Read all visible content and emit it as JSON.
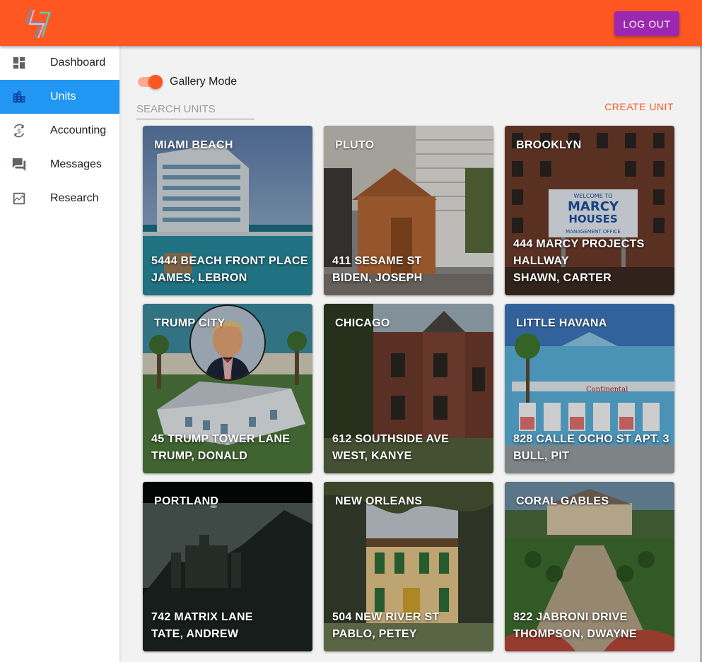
{
  "topbar": {
    "logout_label": "LOG OUT",
    "logo_icon": "lightning-logo-icon",
    "color": "#ff5722",
    "logout_color": "#9c27b0"
  },
  "sidebar": {
    "active_color": "#2196f3",
    "items": [
      {
        "label": "Dashboard",
        "icon": "dashboard-icon",
        "active": false
      },
      {
        "label": "Units",
        "icon": "building-icon",
        "active": true
      },
      {
        "label": "Accounting",
        "icon": "money-sync-icon",
        "active": false
      },
      {
        "label": "Messages",
        "icon": "chat-icon",
        "active": false
      },
      {
        "label": "Research",
        "icon": "chart-icon",
        "active": false
      }
    ]
  },
  "main": {
    "gallery_mode_label": "Gallery Mode",
    "gallery_mode_on": true,
    "search_placeholder": "SEARCH UNITS",
    "search_value": "",
    "create_unit_label": "CREATE UNIT",
    "units": [
      {
        "city": "MIAMI BEACH",
        "address": "5444 BEACH FRONT PLACE",
        "extra": "",
        "tenant": "JAMES, LEBRON"
      },
      {
        "city": "PLUTO",
        "address": "411 SESAME ST",
        "extra": "",
        "tenant": "BIDEN, JOSEPH"
      },
      {
        "city": "BROOKLYN",
        "address": "444 MARCY PROJECTS",
        "extra": "HALLWAY",
        "tenant": "SHAWN, CARTER",
        "sign_line1": "WELCOME TO",
        "sign_line2": "MARCY",
        "sign_line3": "HOUSES",
        "sign_line4": "MANAGEMENT OFFICE"
      },
      {
        "city": "TRUMP CITY",
        "address": "45 TRUMP TOWER LANE",
        "extra": "",
        "tenant": "TRUMP, DONALD"
      },
      {
        "city": "CHICAGO",
        "address": "612 SOUTHSIDE AVE",
        "extra": "",
        "tenant": "WEST, KANYE"
      },
      {
        "city": "LITTLE HAVANA",
        "address": "828 CALLE OCHO ST APT. 3",
        "extra": "",
        "tenant": "BULL, PIT",
        "store_sign": "Continental"
      },
      {
        "city": "PORTLAND",
        "address": "742 MATRIX LANE",
        "extra": "",
        "tenant": "TATE, ANDREW"
      },
      {
        "city": "NEW ORLEANS",
        "address": "504 NEW RIVER ST",
        "extra": "",
        "tenant": "PABLO, PETEY"
      },
      {
        "city": "CORAL GABLES",
        "address": "822 JABRONI DRIVE",
        "extra": "",
        "tenant": "THOMPSON, DWAYNE"
      }
    ]
  }
}
